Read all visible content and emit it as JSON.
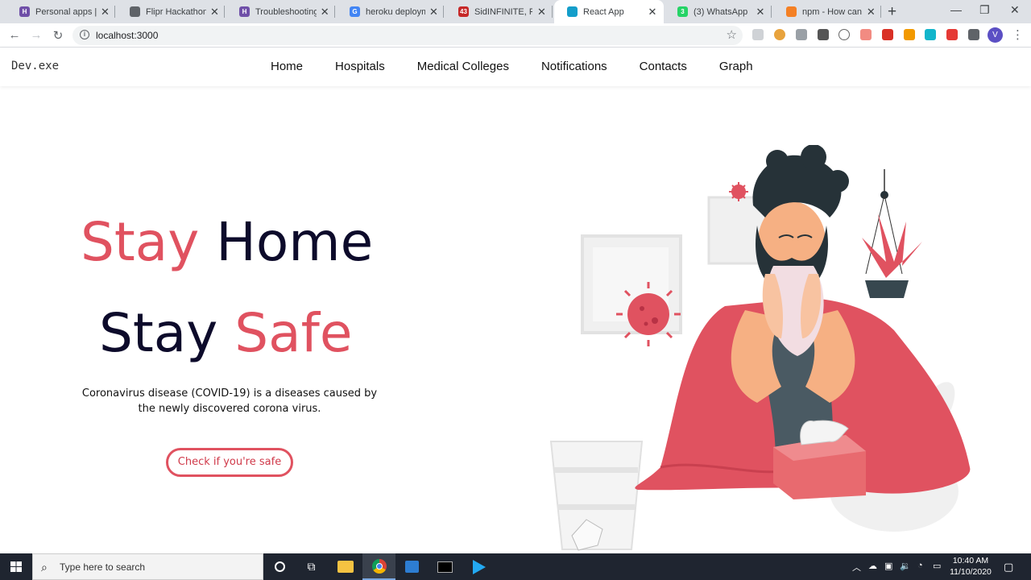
{
  "browser": {
    "tabs": [
      {
        "title": "Personal apps | He",
        "favicon": "heroku-icon",
        "color": "#6f4fa8",
        "glyph": "H"
      },
      {
        "title": "Flipr Hackathon Ta",
        "favicon": "globe-icon",
        "color": "#5f6368",
        "glyph": ""
      },
      {
        "title": "Troubleshooting N",
        "favicon": "heroku-icon",
        "color": "#6f4fa8",
        "glyph": "H"
      },
      {
        "title": "heroku deploymen",
        "favicon": "google-icon",
        "color": "#4285f4",
        "glyph": "G"
      },
      {
        "title": "SidINFINITE, R",
        "favicon": "github-icon",
        "color": "#c62828",
        "glyph": "43"
      },
      {
        "title": "React App",
        "favicon": "react-icon",
        "color": "#149eca",
        "glyph": ""
      },
      {
        "title": "(3) WhatsApp",
        "favicon": "whatsapp-icon",
        "color": "#25d366",
        "glyph": "3"
      },
      {
        "title": "npm - How can I s",
        "favicon": "stackoverflow-icon",
        "color": "#f48024",
        "glyph": ""
      }
    ],
    "new_tab": "+",
    "window_controls": {
      "minimize": "—",
      "restore": "❐",
      "close": "✕"
    },
    "url": "localhost:3000",
    "profile_initial": "V"
  },
  "site": {
    "brand": "Dev.exe",
    "nav": [
      "Home",
      "Hospitals",
      "Medical Colleges",
      "Notifications",
      "Contacts",
      "Graph"
    ],
    "hero": {
      "line1_a": "Stay",
      "line1_b": "Home",
      "line2_a": "Stay",
      "line2_b": "Safe",
      "description": "Coronavirus disease (COVID-19) is a diseases caused by the newly discovered corona virus.",
      "cta": "Check if you're safe"
    },
    "colors": {
      "accent": "#e05260",
      "dark": "#0d0b2b"
    }
  },
  "taskbar": {
    "search_placeholder": "Type here to search",
    "time": "10:40 AM",
    "date": "11/10/2020"
  }
}
